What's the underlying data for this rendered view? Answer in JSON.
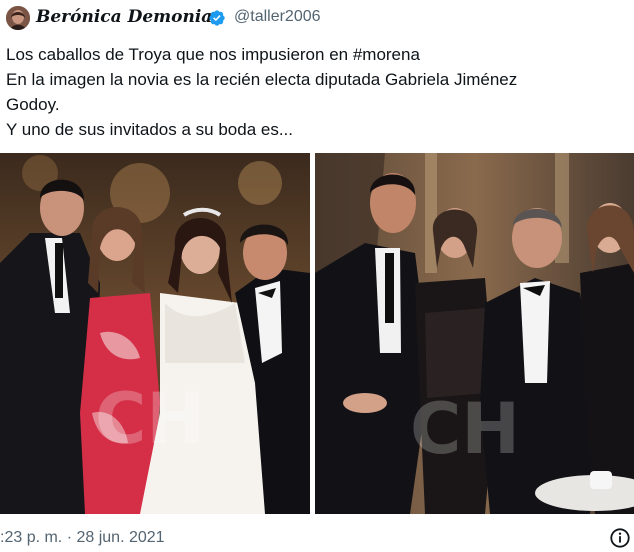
{
  "tweet": {
    "display_name": "Berónica Demonia",
    "handle": "@taller2006",
    "verified": true,
    "text_lines": [
      "Los caballos de Troya que nos impusieron en #morena",
      "En la imagen la novia es la recién electa diputada Gabriela Jiménez",
      "Godoy.",
      "Y uno de sus invitados a su boda es..."
    ],
    "timestamp": ":23 p. m. · 28 jun. 2021"
  },
  "colors": {
    "handle_gray": "#536471",
    "verified_blue": "#1d9bf0",
    "text": "#0f1419"
  },
  "icons": [
    "verified-badge-icon",
    "info-icon"
  ]
}
